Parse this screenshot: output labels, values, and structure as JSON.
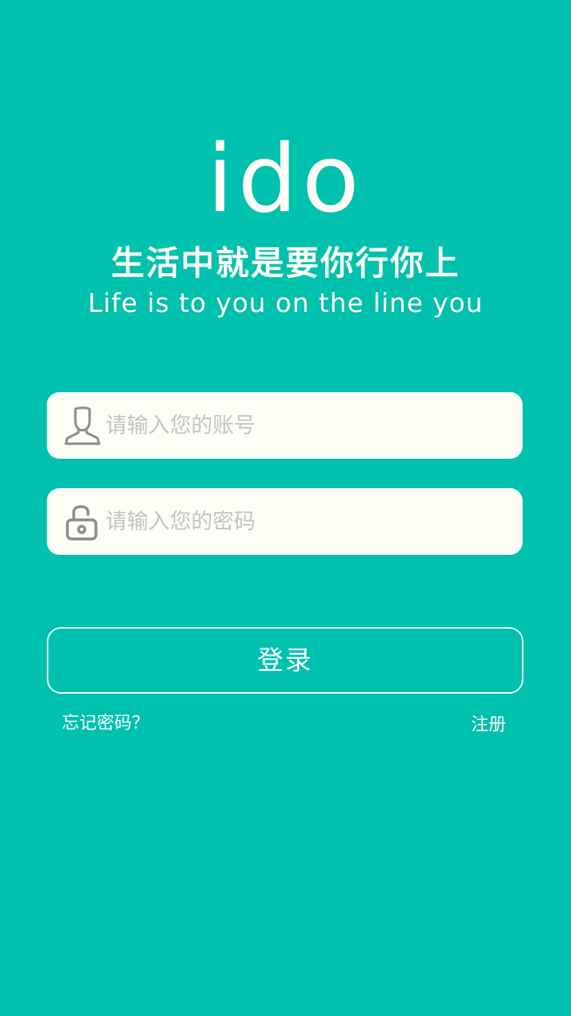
{
  "brand": {
    "logo_text": "ido",
    "slogan_cn": "生活中就是要你行你上",
    "slogan_en": "Life is to you on the line you"
  },
  "form": {
    "account_placeholder": "请输入您的账号",
    "account_value": "",
    "account_icon": "user-icon",
    "password_placeholder": "请输入您的密码",
    "password_value": "",
    "password_icon": "unlock-icon",
    "login_label": "登录",
    "forgot_label": "忘记密码？",
    "register_label": "注册"
  },
  "colors": {
    "background": "#00C1AD",
    "field_background": "#FDFEF5",
    "placeholder": "#C3C3C3",
    "icon_stroke": "#8C8C8C",
    "text": "#FFFFFF"
  }
}
